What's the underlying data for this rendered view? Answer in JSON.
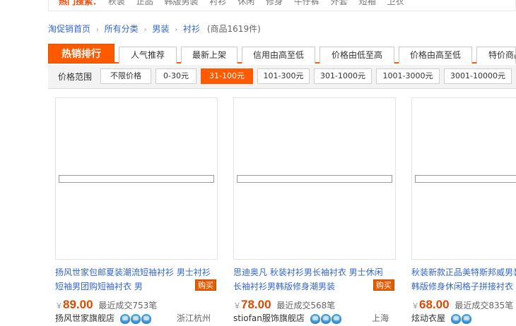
{
  "hot_search": {
    "label": "热门搜索：",
    "terms": [
      "秋装",
      "正品",
      "韩版男装",
      "衬衫",
      "休闲",
      "修身",
      "牛仔裤",
      "外套",
      "短袖",
      "卫衣"
    ]
  },
  "breadcrumb": {
    "items": [
      "淘促销首页",
      "所有分类",
      "男装",
      "衬衫"
    ],
    "count": "(商品1619件)"
  },
  "sort_tabs": {
    "active": "热销排行",
    "items": [
      "人气推荐",
      "最新上架",
      "信用由高至低",
      "价格由低至高",
      "价格由高至低",
      "特价商品"
    ]
  },
  "price_filter": {
    "label": "价格范围",
    "options": [
      "不限价格",
      "0-30元",
      "31-100元",
      "101-300元",
      "301-1000元",
      "1001-3000元",
      "3001-10000元"
    ],
    "selected": "31-100元"
  },
  "products": [
    {
      "title_line1": "扬风世家包邮夏装潮流短袖衬衫 男士衬衫",
      "title_line2": "短袖男团购短袖衬衣 男",
      "buy_label": "购买",
      "currency": "￥",
      "price": "89.00",
      "sold": "最近成交753笔",
      "shop": "扬风世家旗舰店",
      "location": "浙江杭州",
      "crowns": 3
    },
    {
      "title_line1": "思迪奥凡 秋装衬衫男长袖衬衣 男士休闲",
      "title_line2": "长袖衬衫男韩版修身潮男装",
      "buy_label": "购买",
      "currency": "￥",
      "price": "78.00",
      "sold": "最近成交568笔",
      "shop": "stiofan服饰旗舰店",
      "location": "上海",
      "crowns": 4
    },
    {
      "title_line1": "秋装新款正品美特斯邦威男装",
      "title_line2": "韩版修身休闲格子拼接衬衣",
      "buy_label": "购买",
      "currency": "￥",
      "price": "68.00",
      "sold": "最近成交835笔",
      "shop": "炫动衣屋",
      "location": "",
      "crowns": 2
    }
  ],
  "colors": {
    "accent": "#ff5a00",
    "link": "#3366cc",
    "price": "#e04800"
  }
}
